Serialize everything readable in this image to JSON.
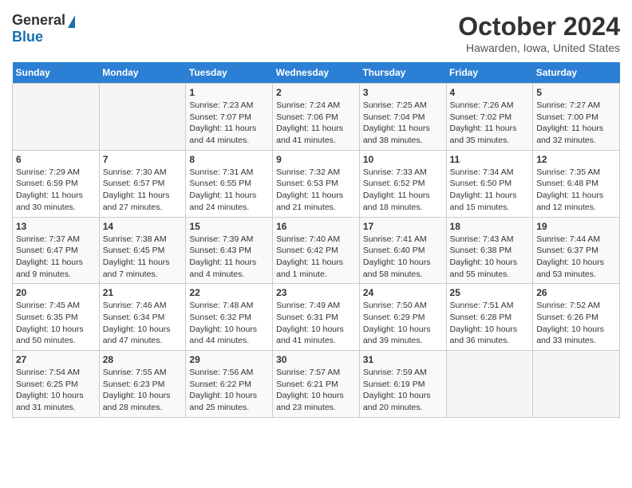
{
  "logo": {
    "general": "General",
    "blue": "Blue"
  },
  "title": "October 2024",
  "subtitle": "Hawarden, Iowa, United States",
  "days_of_week": [
    "Sunday",
    "Monday",
    "Tuesday",
    "Wednesday",
    "Thursday",
    "Friday",
    "Saturday"
  ],
  "weeks": [
    [
      {
        "day": "",
        "sunrise": "",
        "sunset": "",
        "daylight": "",
        "empty": true
      },
      {
        "day": "",
        "sunrise": "",
        "sunset": "",
        "daylight": "",
        "empty": true
      },
      {
        "day": "1",
        "sunrise": "Sunrise: 7:23 AM",
        "sunset": "Sunset: 7:07 PM",
        "daylight": "Daylight: 11 hours and 44 minutes."
      },
      {
        "day": "2",
        "sunrise": "Sunrise: 7:24 AM",
        "sunset": "Sunset: 7:06 PM",
        "daylight": "Daylight: 11 hours and 41 minutes."
      },
      {
        "day": "3",
        "sunrise": "Sunrise: 7:25 AM",
        "sunset": "Sunset: 7:04 PM",
        "daylight": "Daylight: 11 hours and 38 minutes."
      },
      {
        "day": "4",
        "sunrise": "Sunrise: 7:26 AM",
        "sunset": "Sunset: 7:02 PM",
        "daylight": "Daylight: 11 hours and 35 minutes."
      },
      {
        "day": "5",
        "sunrise": "Sunrise: 7:27 AM",
        "sunset": "Sunset: 7:00 PM",
        "daylight": "Daylight: 11 hours and 32 minutes."
      }
    ],
    [
      {
        "day": "6",
        "sunrise": "Sunrise: 7:29 AM",
        "sunset": "Sunset: 6:59 PM",
        "daylight": "Daylight: 11 hours and 30 minutes."
      },
      {
        "day": "7",
        "sunrise": "Sunrise: 7:30 AM",
        "sunset": "Sunset: 6:57 PM",
        "daylight": "Daylight: 11 hours and 27 minutes."
      },
      {
        "day": "8",
        "sunrise": "Sunrise: 7:31 AM",
        "sunset": "Sunset: 6:55 PM",
        "daylight": "Daylight: 11 hours and 24 minutes."
      },
      {
        "day": "9",
        "sunrise": "Sunrise: 7:32 AM",
        "sunset": "Sunset: 6:53 PM",
        "daylight": "Daylight: 11 hours and 21 minutes."
      },
      {
        "day": "10",
        "sunrise": "Sunrise: 7:33 AM",
        "sunset": "Sunset: 6:52 PM",
        "daylight": "Daylight: 11 hours and 18 minutes."
      },
      {
        "day": "11",
        "sunrise": "Sunrise: 7:34 AM",
        "sunset": "Sunset: 6:50 PM",
        "daylight": "Daylight: 11 hours and 15 minutes."
      },
      {
        "day": "12",
        "sunrise": "Sunrise: 7:35 AM",
        "sunset": "Sunset: 6:48 PM",
        "daylight": "Daylight: 11 hours and 12 minutes."
      }
    ],
    [
      {
        "day": "13",
        "sunrise": "Sunrise: 7:37 AM",
        "sunset": "Sunset: 6:47 PM",
        "daylight": "Daylight: 11 hours and 9 minutes."
      },
      {
        "day": "14",
        "sunrise": "Sunrise: 7:38 AM",
        "sunset": "Sunset: 6:45 PM",
        "daylight": "Daylight: 11 hours and 7 minutes."
      },
      {
        "day": "15",
        "sunrise": "Sunrise: 7:39 AM",
        "sunset": "Sunset: 6:43 PM",
        "daylight": "Daylight: 11 hours and 4 minutes."
      },
      {
        "day": "16",
        "sunrise": "Sunrise: 7:40 AM",
        "sunset": "Sunset: 6:42 PM",
        "daylight": "Daylight: 11 hours and 1 minute."
      },
      {
        "day": "17",
        "sunrise": "Sunrise: 7:41 AM",
        "sunset": "Sunset: 6:40 PM",
        "daylight": "Daylight: 10 hours and 58 minutes."
      },
      {
        "day": "18",
        "sunrise": "Sunrise: 7:43 AM",
        "sunset": "Sunset: 6:38 PM",
        "daylight": "Daylight: 10 hours and 55 minutes."
      },
      {
        "day": "19",
        "sunrise": "Sunrise: 7:44 AM",
        "sunset": "Sunset: 6:37 PM",
        "daylight": "Daylight: 10 hours and 53 minutes."
      }
    ],
    [
      {
        "day": "20",
        "sunrise": "Sunrise: 7:45 AM",
        "sunset": "Sunset: 6:35 PM",
        "daylight": "Daylight: 10 hours and 50 minutes."
      },
      {
        "day": "21",
        "sunrise": "Sunrise: 7:46 AM",
        "sunset": "Sunset: 6:34 PM",
        "daylight": "Daylight: 10 hours and 47 minutes."
      },
      {
        "day": "22",
        "sunrise": "Sunrise: 7:48 AM",
        "sunset": "Sunset: 6:32 PM",
        "daylight": "Daylight: 10 hours and 44 minutes."
      },
      {
        "day": "23",
        "sunrise": "Sunrise: 7:49 AM",
        "sunset": "Sunset: 6:31 PM",
        "daylight": "Daylight: 10 hours and 41 minutes."
      },
      {
        "day": "24",
        "sunrise": "Sunrise: 7:50 AM",
        "sunset": "Sunset: 6:29 PM",
        "daylight": "Daylight: 10 hours and 39 minutes."
      },
      {
        "day": "25",
        "sunrise": "Sunrise: 7:51 AM",
        "sunset": "Sunset: 6:28 PM",
        "daylight": "Daylight: 10 hours and 36 minutes."
      },
      {
        "day": "26",
        "sunrise": "Sunrise: 7:52 AM",
        "sunset": "Sunset: 6:26 PM",
        "daylight": "Daylight: 10 hours and 33 minutes."
      }
    ],
    [
      {
        "day": "27",
        "sunrise": "Sunrise: 7:54 AM",
        "sunset": "Sunset: 6:25 PM",
        "daylight": "Daylight: 10 hours and 31 minutes."
      },
      {
        "day": "28",
        "sunrise": "Sunrise: 7:55 AM",
        "sunset": "Sunset: 6:23 PM",
        "daylight": "Daylight: 10 hours and 28 minutes."
      },
      {
        "day": "29",
        "sunrise": "Sunrise: 7:56 AM",
        "sunset": "Sunset: 6:22 PM",
        "daylight": "Daylight: 10 hours and 25 minutes."
      },
      {
        "day": "30",
        "sunrise": "Sunrise: 7:57 AM",
        "sunset": "Sunset: 6:21 PM",
        "daylight": "Daylight: 10 hours and 23 minutes."
      },
      {
        "day": "31",
        "sunrise": "Sunrise: 7:59 AM",
        "sunset": "Sunset: 6:19 PM",
        "daylight": "Daylight: 10 hours and 20 minutes."
      },
      {
        "day": "",
        "sunrise": "",
        "sunset": "",
        "daylight": "",
        "empty": true
      },
      {
        "day": "",
        "sunrise": "",
        "sunset": "",
        "daylight": "",
        "empty": true
      }
    ]
  ]
}
